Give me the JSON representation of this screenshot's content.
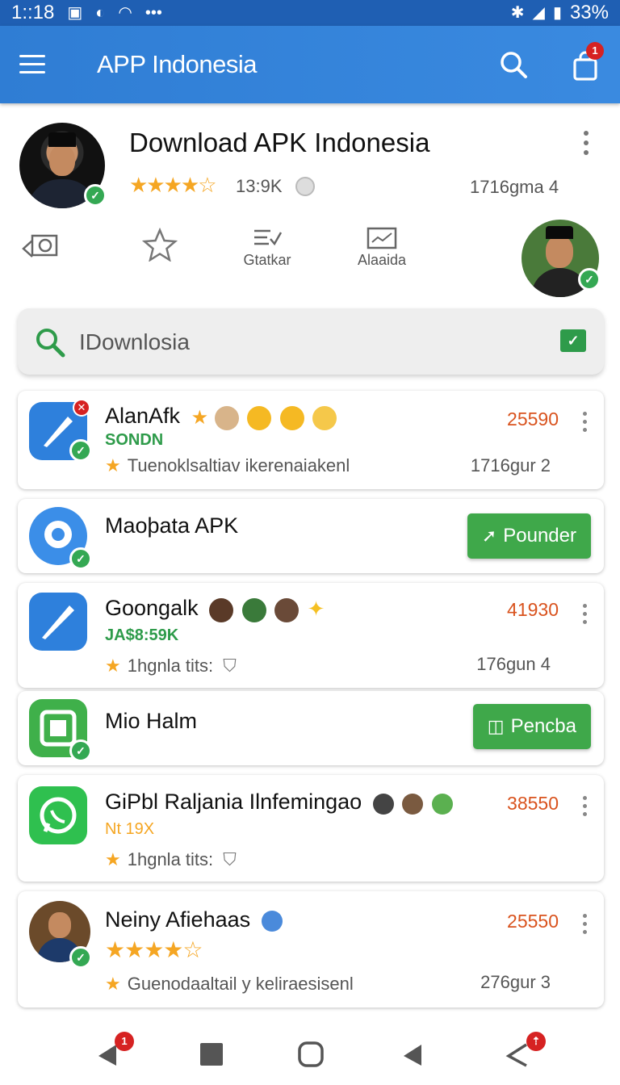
{
  "status_bar": {
    "time": "1::18",
    "battery": "33%"
  },
  "app_bar": {
    "title": "APP Indonesia",
    "cart_badge": "1"
  },
  "header": {
    "title": "Download APK Indonesia",
    "rating_stars": "★★★★☆",
    "rating_count": "13:9K",
    "meta": "1716gma 4",
    "actions": [
      {
        "icon": "camera-icon",
        "label": ""
      },
      {
        "icon": "star-icon",
        "label": ""
      },
      {
        "icon": "list-icon",
        "label": "Gtatkar"
      },
      {
        "icon": "chart-icon",
        "label": "Alaaida"
      }
    ]
  },
  "search": {
    "value": "IDownlosia"
  },
  "apps": [
    {
      "name": "AlanAfk",
      "sub": "SONDN",
      "desc": "Tuenoklsaltiav ikerenaiakenl",
      "count": "25590",
      "meta": "1716gur 2",
      "icon_color": "#2e80dc",
      "sub_color": "#2e9b4a"
    },
    {
      "name": "Maoþata APK",
      "button": "Pounder",
      "icon_color": "#3b8ee8"
    },
    {
      "name": "Goongalk",
      "sub": "JA$8:59K",
      "desc": "1hgnla tits:",
      "count": "41930",
      "meta": "176gun 4",
      "icon_color": "#2e80dc",
      "sub_color": "#2e9b4a"
    },
    {
      "name": "Mio Halm",
      "button": "Pencba",
      "icon_color": "#3fb04a"
    },
    {
      "name": "GiPbl Raljania Ilnfemingao",
      "sub": "Nt 19X",
      "desc": "1hgnla tits:",
      "count": "38550",
      "icon_color": "#2fc04f",
      "sub_color": "#f5a623"
    },
    {
      "name": "Neiny Afiehaas",
      "stars": "★★★★☆",
      "desc": "Guenodaaltail y keliraesisenl",
      "count": "25550",
      "meta": "276gur 3"
    }
  ],
  "nav": {
    "back_badge": "1"
  }
}
